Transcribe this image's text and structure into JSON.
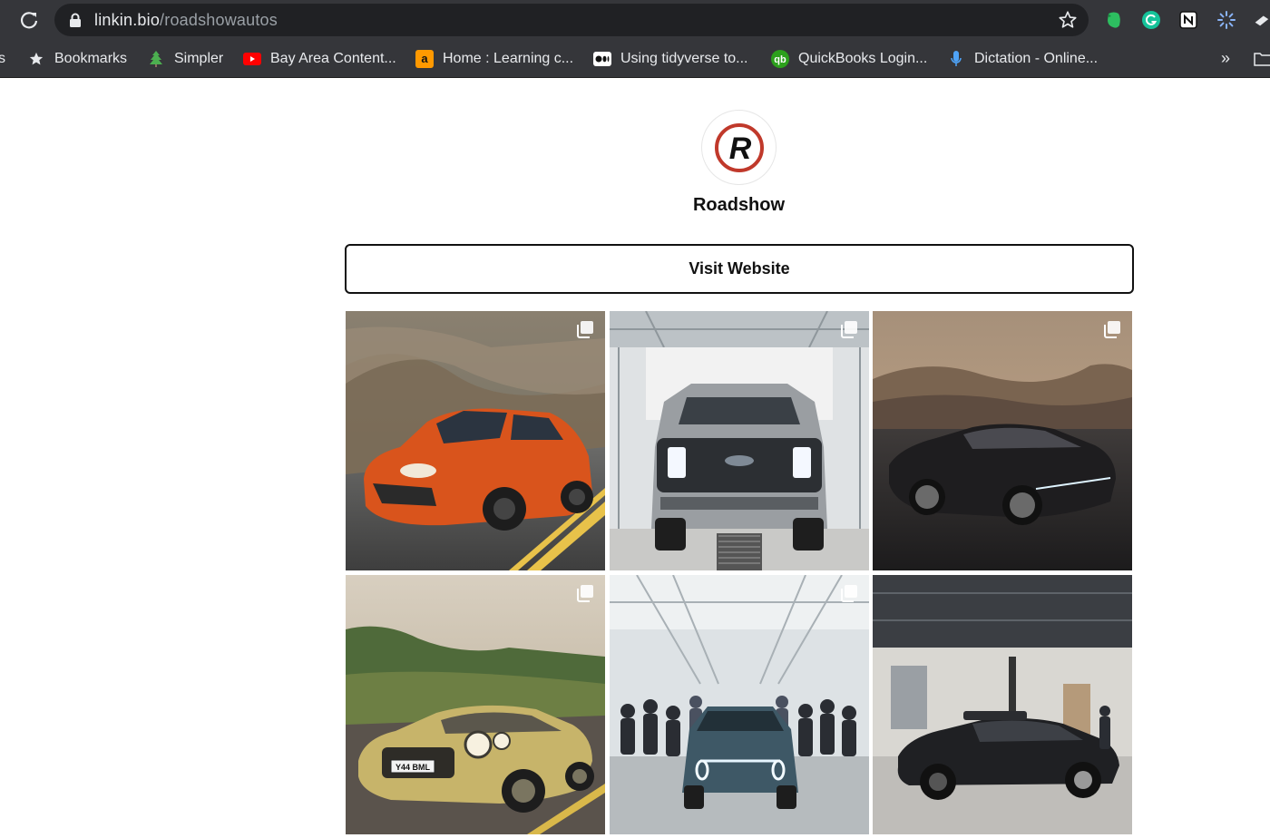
{
  "browser": {
    "url_host": "linkin.bio",
    "url_path": "/roadshowautos"
  },
  "bookmarks": [
    {
      "label": "s",
      "icon": "truncated-item"
    },
    {
      "label": "Bookmarks",
      "icon": "star-icon"
    },
    {
      "label": "Simpler",
      "icon": "leaf-icon"
    },
    {
      "label": "Bay Area Content...",
      "icon": "youtube-icon"
    },
    {
      "label": "Home : Learning c...",
      "icon": "amazon-icon"
    },
    {
      "label": "Using tidyverse to...",
      "icon": "medium-icon"
    },
    {
      "label": "QuickBooks Login...",
      "icon": "quickbooks-icon"
    },
    {
      "label": "Dictation - Online...",
      "icon": "microphone-icon"
    }
  ],
  "bookmarks_overflow": "»",
  "profile": {
    "logo_letter": "R",
    "name": "Roadshow"
  },
  "visit_button": "Visit Website",
  "colors": {
    "chrome_bg": "#35363a",
    "omnibox_bg": "#202124",
    "logo_red": "#c0392b",
    "porsche_orange": "#d9541c",
    "bentley_gold": "#c7b46a"
  },
  "grid": [
    {
      "name": "orange-porsche-suv-post",
      "icon": "multi-image-icon"
    },
    {
      "name": "electric-pickup-factory-post",
      "icon": "multi-image-icon"
    },
    {
      "name": "black-sedan-desert-post",
      "icon": "multi-image-icon"
    },
    {
      "name": "gold-bentley-coupe-post",
      "icon": "multi-image-icon"
    },
    {
      "name": "factory-workers-suv-post",
      "icon": "multi-image-icon"
    },
    {
      "name": "prototype-sedan-workshop-post",
      "icon": ""
    }
  ],
  "plates": {
    "bentley_plate": "Y44 BML"
  }
}
